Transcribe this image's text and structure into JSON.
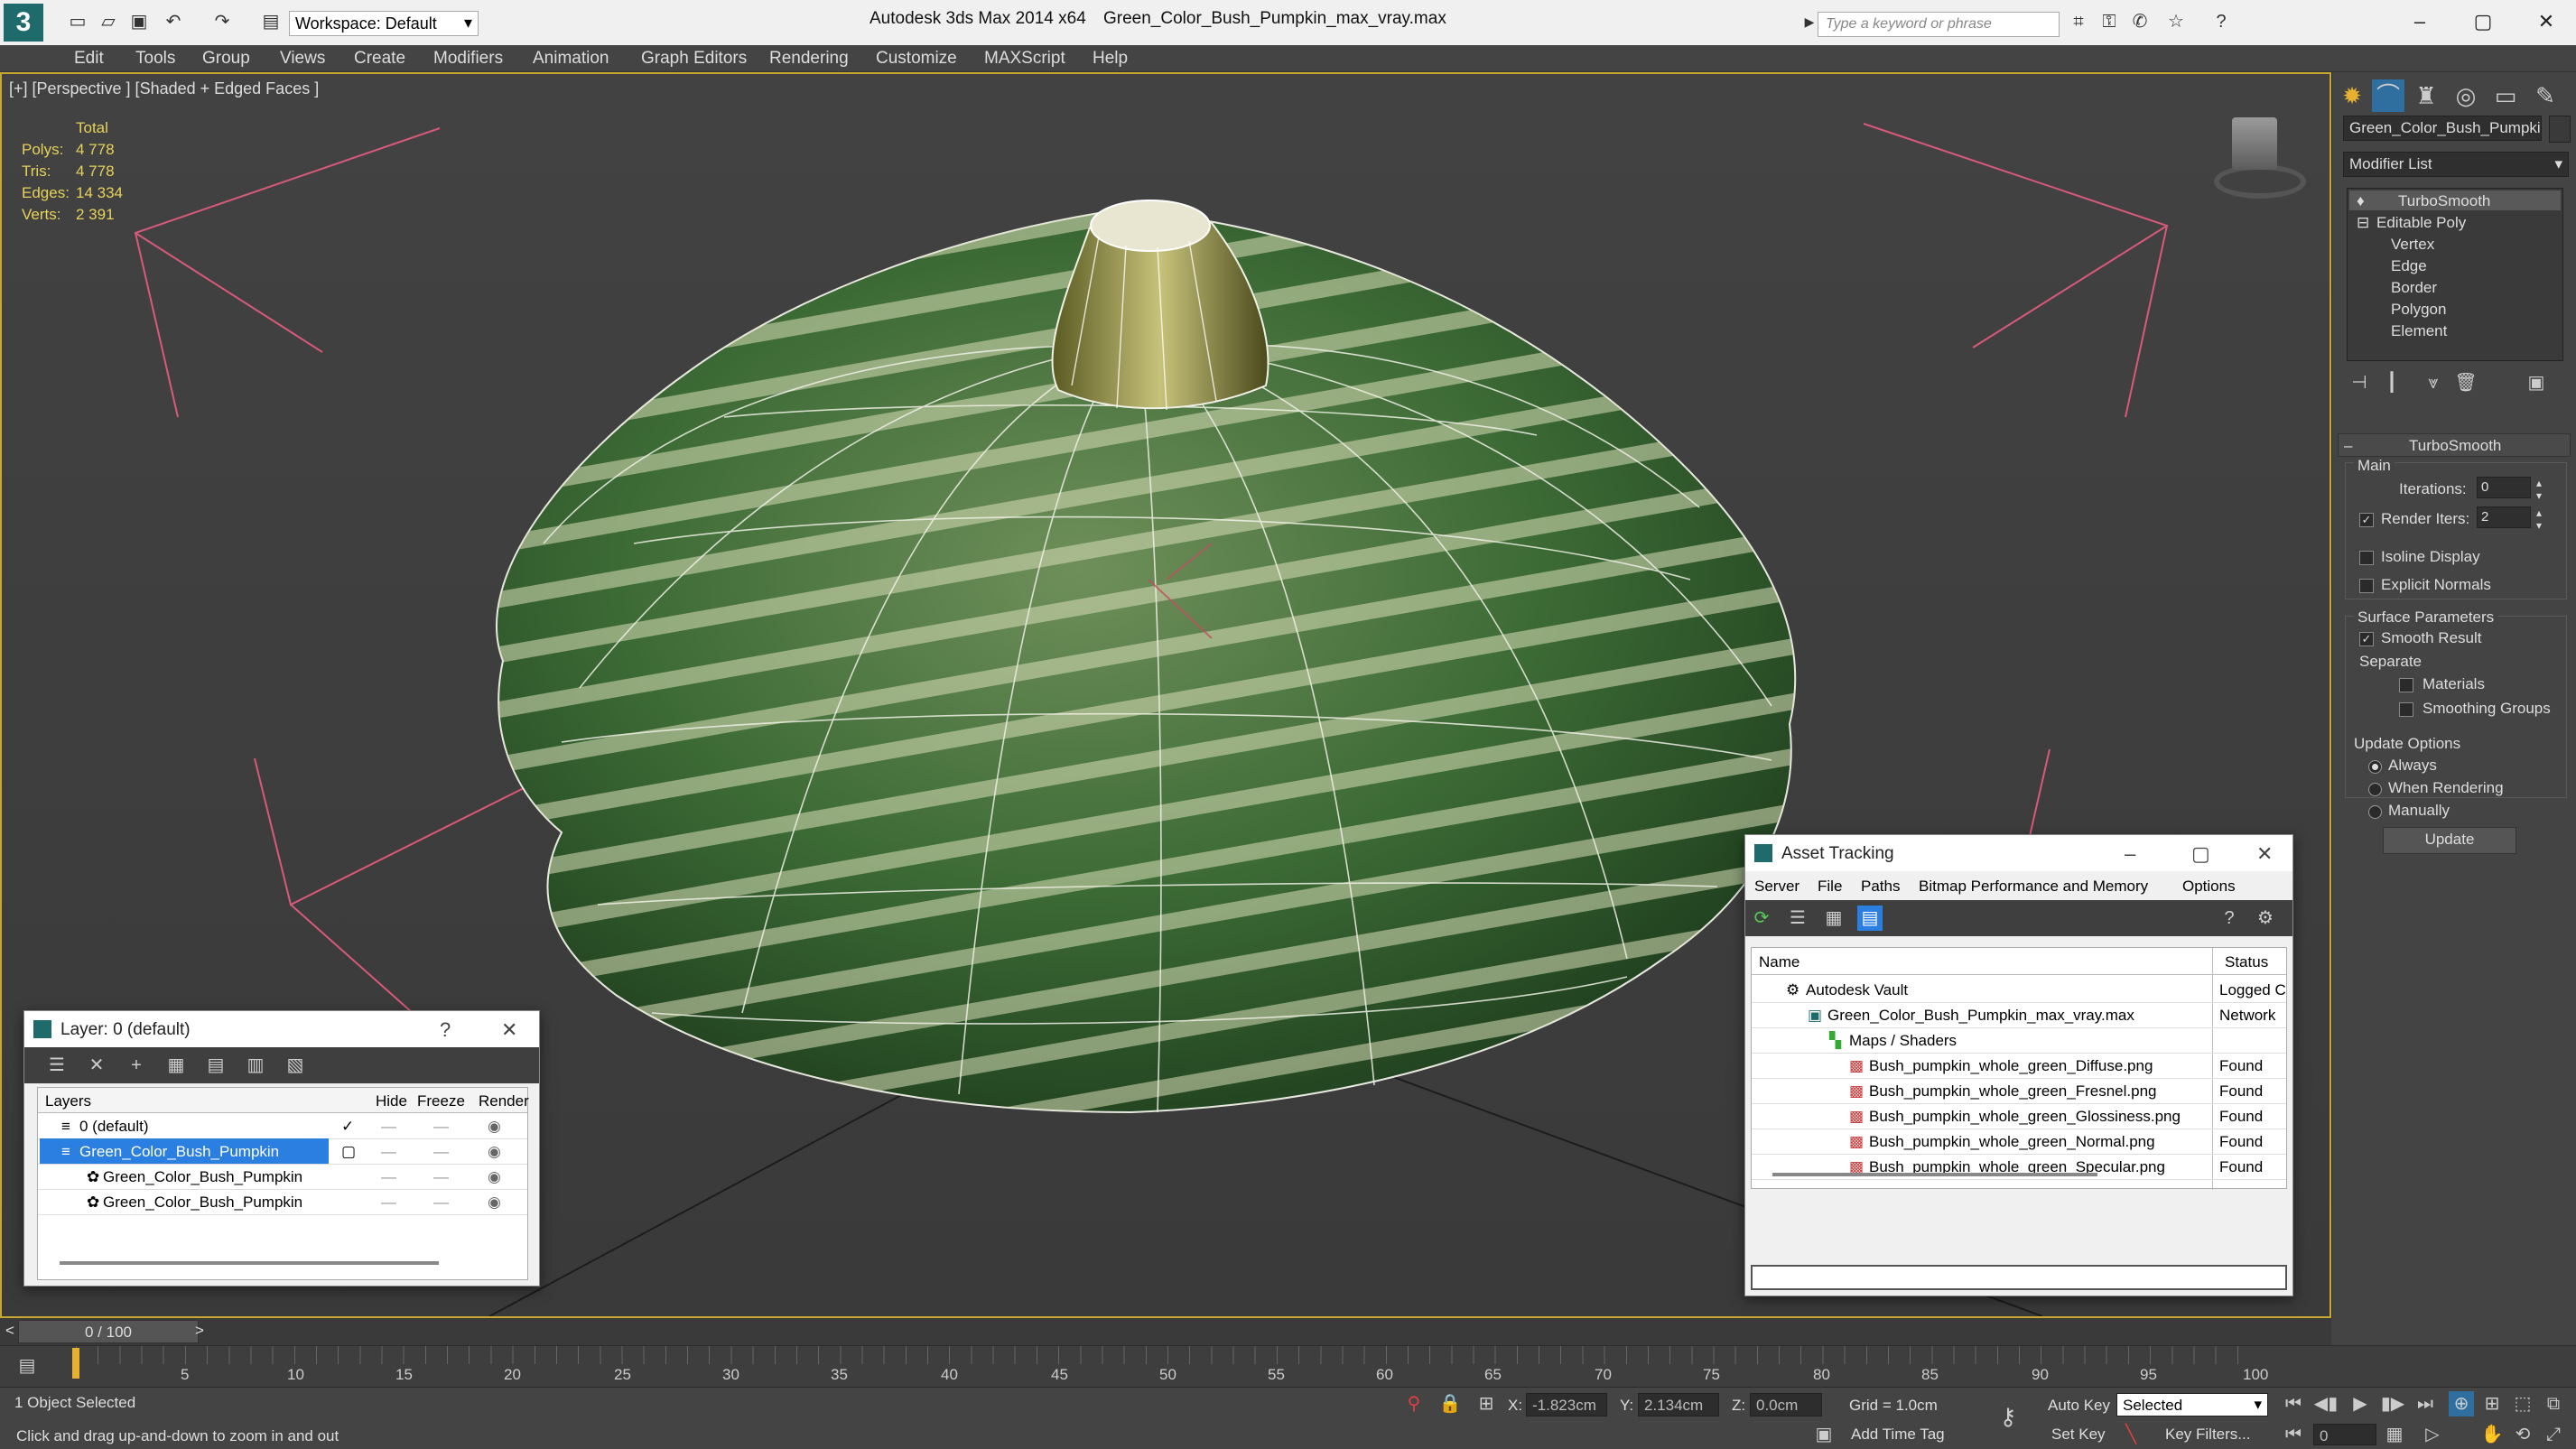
{
  "app": {
    "title": "Autodesk 3ds Max  2014 x64",
    "filename": "Green_Color_Bush_Pumpkin_max_vray.max",
    "workspace": "Workspace: Default",
    "search_placeholder": "Type a keyword or phrase"
  },
  "menu": [
    "Edit",
    "Tools",
    "Group",
    "Views",
    "Create",
    "Modifiers",
    "Animation",
    "Graph Editors",
    "Rendering",
    "Customize",
    "MAXScript",
    "Help"
  ],
  "viewport": {
    "label": "[+] [Perspective ] [Shaded + Edged Faces ]",
    "stats": {
      "header": "Total",
      "rows": [
        {
          "k": "Polys:",
          "v": "4 778"
        },
        {
          "k": "Tris:",
          "v": "4 778"
        },
        {
          "k": "Edges:",
          "v": "14 334"
        },
        {
          "k": "Verts:",
          "v": "2 391"
        }
      ]
    }
  },
  "command_panel": {
    "object_name": "Green_Color_Bush_Pumpkin",
    "modifier_list": "Modifier List",
    "stack": [
      "TurboSmooth",
      "Editable Poly",
      "Vertex",
      "Edge",
      "Border",
      "Polygon",
      "Element"
    ],
    "rollout": "TurboSmooth",
    "main_label": "Main",
    "iterations_label": "Iterations:",
    "iterations": "0",
    "render_iters_label": "Render Iters:",
    "render_iters": "2",
    "isoline": "Isoline Display",
    "explicit_normals": "Explicit Normals",
    "surface_params": "Surface Parameters",
    "smooth_result": "Smooth Result",
    "separate": "Separate",
    "materials": "Materials",
    "smoothing_groups": "Smoothing Groups",
    "update_options": "Update Options",
    "always": "Always",
    "when_rendering": "When Rendering",
    "manually": "Manually",
    "update_button": "Update"
  },
  "layer_dialog": {
    "title": "Layer: 0 (default)",
    "help": "?",
    "columns": [
      "Layers",
      "Hide",
      "Freeze",
      "Render"
    ],
    "rows": [
      {
        "name": "0 (default)"
      },
      {
        "name": "Green_Color_Bush_Pumpkin"
      },
      {
        "name": "Green_Color_Bush_Pumpkin"
      },
      {
        "name": "Green_Color_Bush_Pumpkin"
      }
    ]
  },
  "asset_dialog": {
    "title": "Asset Tracking",
    "menu": [
      "Server",
      "File",
      "Paths",
      "Bitmap Performance and Memory",
      "Options"
    ],
    "columns": [
      "Name",
      "Status"
    ],
    "rows": [
      {
        "name": "Autodesk Vault",
        "status": "Logged C"
      },
      {
        "name": "Green_Color_Bush_Pumpkin_max_vray.max",
        "status": "Network"
      },
      {
        "name": "Maps / Shaders",
        "status": ""
      },
      {
        "name": "Bush_pumpkin_whole_green_Diffuse.png",
        "status": "Found"
      },
      {
        "name": "Bush_pumpkin_whole_green_Fresnel.png",
        "status": "Found"
      },
      {
        "name": "Bush_pumpkin_whole_green_Glossiness.png",
        "status": "Found"
      },
      {
        "name": "Bush_pumpkin_whole_green_Normal.png",
        "status": "Found"
      },
      {
        "name": "Bush_pumpkin_whole_green_Specular.png",
        "status": "Found"
      }
    ]
  },
  "timeline": {
    "frame": "0 / 100",
    "ticks": [
      "5",
      "10",
      "15",
      "20",
      "25",
      "30",
      "35",
      "40",
      "45",
      "50",
      "55",
      "60",
      "65",
      "70",
      "75",
      "80",
      "85",
      "90",
      "95",
      "100"
    ]
  },
  "status": {
    "selected": "1 Object Selected",
    "prompt": "Click and drag up-and-down to zoom in and out",
    "x_label": "X:",
    "x": "-1.823cm",
    "y_label": "Y:",
    "y": "2.134cm",
    "z_label": "Z:",
    "z": "0.0cm",
    "grid": "Grid = 1.0cm",
    "auto_key": "Auto Key",
    "selected_dropdown": "Selected",
    "set_key": "Set Key",
    "key_filters": "Key Filters...",
    "add_time_tag": "Add Time Tag",
    "frame_field": "0"
  }
}
